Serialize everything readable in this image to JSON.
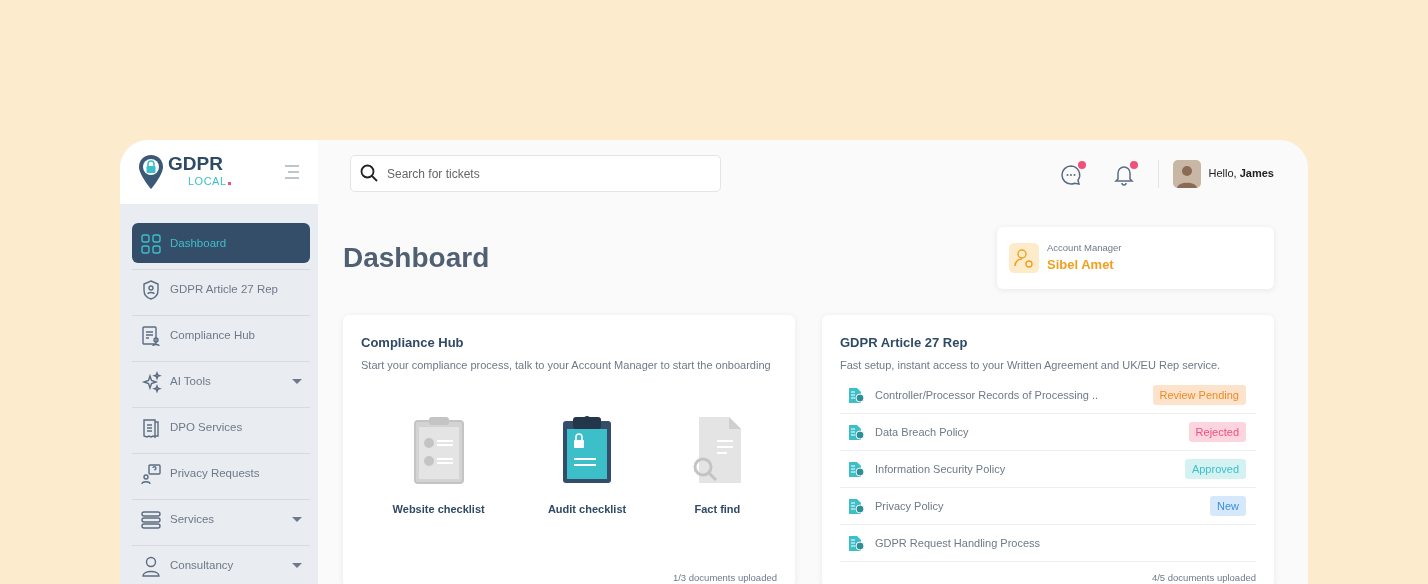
{
  "brand": {
    "name": "GDPR",
    "sub": "LOCAL"
  },
  "sidebar": {
    "items": [
      {
        "label": "Dashboard",
        "selected": true,
        "expandable": false
      },
      {
        "label": "GDPR Article 27 Rep",
        "selected": false,
        "expandable": false
      },
      {
        "label": "Compliance Hub",
        "selected": false,
        "expandable": false
      },
      {
        "label": "AI Tools",
        "selected": false,
        "expandable": true
      },
      {
        "label": "DPO Services",
        "selected": false,
        "expandable": false
      },
      {
        "label": "Privacy Requests",
        "selected": false,
        "expandable": false
      },
      {
        "label": "Services",
        "selected": false,
        "expandable": true
      },
      {
        "label": "Consultancy",
        "selected": false,
        "expandable": true
      }
    ]
  },
  "search": {
    "placeholder": "Search for tickets"
  },
  "header": {
    "messages_unread": true,
    "notifications_unread": true,
    "greeting": "Hello, **James**"
  },
  "page_title": "Dashboard",
  "account_manager": {
    "label": "Account Manager",
    "name": "Sibel Amet"
  },
  "compliance_hub": {
    "title": "Compliance Hub",
    "description": "Start your compliance process, talk to your Account Manager to start the onboarding",
    "items": [
      {
        "label": "Website checklist",
        "kind": "checklist"
      },
      {
        "label": "Audit checklist",
        "kind": "locked"
      },
      {
        "label": "Fact find",
        "kind": "search-document"
      }
    ],
    "footer": "1/3 documents uploaded"
  },
  "article27": {
    "title": "GDPR Article 27 Rep",
    "description": "Fast setup, instant access to your Written Agreement and UK/EU Rep service.",
    "documents": [
      {
        "name": "Controller/Processor Records of Processing ..",
        "status": "Review Pending",
        "kind": "pending"
      },
      {
        "name": "Data Breach Policy",
        "status": "Rejected",
        "kind": "rejected"
      },
      {
        "name": "Information Security Policy",
        "status": "Approved",
        "kind": "approved"
      },
      {
        "name": "Privacy Policy",
        "status": "New",
        "kind": "new"
      },
      {
        "name": "GDPR Request Handling Process",
        "kind": "none"
      }
    ],
    "footer": "4/5 documents uploaded"
  }
}
